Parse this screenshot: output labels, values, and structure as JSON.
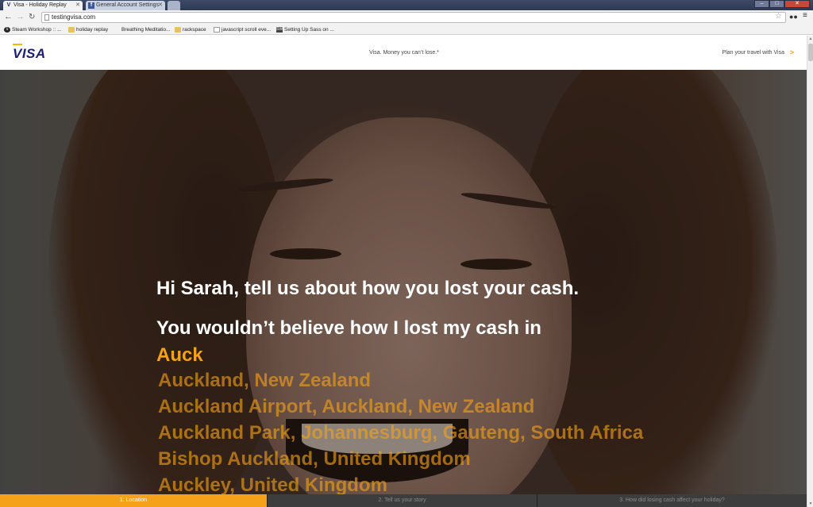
{
  "browser": {
    "tabs": [
      {
        "title": "Visa - Holiday Replay",
        "favicon": "V",
        "active": true
      },
      {
        "title": "General Account Settings",
        "favicon": "f",
        "active": false
      }
    ],
    "url": "testingvisa.com",
    "bookmarks": [
      {
        "label": "Steam Workshop :: ...",
        "icon": "steam-icon"
      },
      {
        "label": "holiday replay",
        "icon": "folder-icon"
      },
      {
        "label": "Breathing Meditatio...",
        "icon": "page-icon"
      },
      {
        "label": "rackspace",
        "icon": "folder-icon"
      },
      {
        "label": "javascript scroll eve...",
        "icon": "page-icon"
      },
      {
        "label": "Setting Up Sass on ...",
        "icon": "sitepoint-icon"
      }
    ]
  },
  "header": {
    "logo": "VISA",
    "tagline": "Visa. Money you can’t lose.*",
    "plan_link": "Plan your travel with Visa",
    "plan_arrow": ">"
  },
  "main": {
    "greeting": "Hi Sarah, tell us about how you lost your cash.",
    "prompt": "You wouldn’t believe how I lost my cash in",
    "typed_value": "Auck",
    "suggestions": [
      "Auckland, New Zealand",
      "Auckland Airport, Auckland, New Zealand",
      "Auckland Park, Johannesburg, Gauteng, South Africa",
      "Bishop Auckland, United Kingdom",
      "Auckley, United Kingdom"
    ]
  },
  "steps": [
    {
      "label": "1. Location",
      "active": true
    },
    {
      "label": "2. Tell us your story",
      "active": false
    },
    {
      "label": "3. How did losing cash affect your holiday?",
      "active": false
    }
  ],
  "colors": {
    "accent": "#f5a21a",
    "brand": "#1a1f71"
  }
}
